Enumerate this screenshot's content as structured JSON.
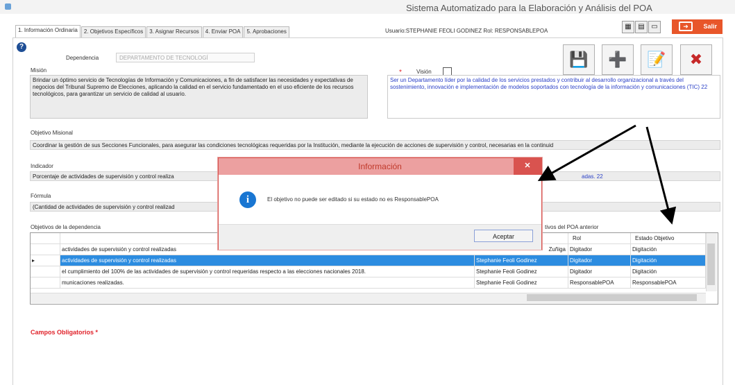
{
  "window": {
    "title": "Sistema Automatizado para la Elaboración y Análisis del POA"
  },
  "tabs": [
    "1. Información Ordinaria",
    "2. Objetivos Específicos",
    "3. Asignar Recursos",
    "4. Enviar POA",
    "5. Aprobaciones"
  ],
  "user_info": "Usuario:STEPHANIE FEOLI GODINEZ  Rol: RESPONSABLEPOA",
  "exit_label": "Salir",
  "form": {
    "dependencia_label": "Dependencia",
    "dependencia_value": "DEPARTAMENTO DE TECNOLOGÍ",
    "mision_label": "Misión",
    "mision_text": "Brindar un óptimo servicio de Tecnologías de Información y Comunicaciones, a fin de satisfacer las necesidades y expectativas de negocios del Tribunal Supremo de Elecciones, aplicando la calidad en el servicio fundamentado en el uso eficiente de los recursos tecnológicos, para garantizar un servicio de calidad al usuario.",
    "vision_label": "Visión",
    "vision_text": "Ser un Departamento líder por la calidad de los servicios prestados y contribuir al desarrollo organizacional a través del sostenimiento, innovación e implementación de modelos soportados con tecnología de la información y comunicaciones (TIC) 22",
    "objetivo_misional_label": "Objetivo Misional",
    "objetivo_misional_text": "Coordinar la gestión de sus Secciones Funcionales, para asegurar las condiciones tecnológicas requeridas por la Institución, mediante la ejecución de acciones de supervisión y control, necesarias en la continuid",
    "indicador_label": "Indicador",
    "indicador_text": "Porcentaje de actividades de supervisión y control realiza",
    "indicador_text_right": "adas. 22",
    "formula_label": "Fórmula",
    "formula_text": "(Cantidad de actividades de supervisión y control realizad",
    "objetivos_label": "Objetivos de la dependencia",
    "objetivos_anterior_label": "tivos del POA anterior"
  },
  "grid": {
    "headers": [
      "",
      "",
      "Rol",
      "Estado Objetivo"
    ],
    "rows": [
      {
        "objetivo": "actividades de supervisión y control realizadas",
        "usuario": "Zuñiga",
        "rol": "Digitador",
        "estado": "Digitación"
      },
      {
        "objetivo": "actividades de supervisión y control realizadas",
        "usuario": "Stephanie Feoli Godinez",
        "rol": "Digitador",
        "estado": "Digitación"
      },
      {
        "objetivo": "el cumplimiento del 100% de las actividades de supervisión y control requeridas respecto a las elecciones nacionales 2018.",
        "usuario": "Stephanie Feoli Godinez",
        "rol": "Digitador",
        "estado": "Digitación"
      },
      {
        "objetivo": "municaciones realizadas.",
        "usuario": "Stephanie Feoli Godinez",
        "rol": "ResponsablePOA",
        "estado": "ResponsablePOA"
      }
    ]
  },
  "campos_obligatorios": "Campos Obligatorios",
  "required_mark": "*",
  "dialog": {
    "title": "Información",
    "close": "✕",
    "message": "El objetivo no puede ser editado si su estado no es ResponsablePOA",
    "ok_label": "Aceptar"
  },
  "colors": {
    "accent": "#2c8ce0",
    "exit": "#e8562a",
    "dialog_border": "#d9534f",
    "required": "#e0222a"
  },
  "icons": [
    "help-icon",
    "save-icon",
    "add-icon",
    "edit-icon",
    "delete-icon",
    "info-icon",
    "exit-icon"
  ]
}
